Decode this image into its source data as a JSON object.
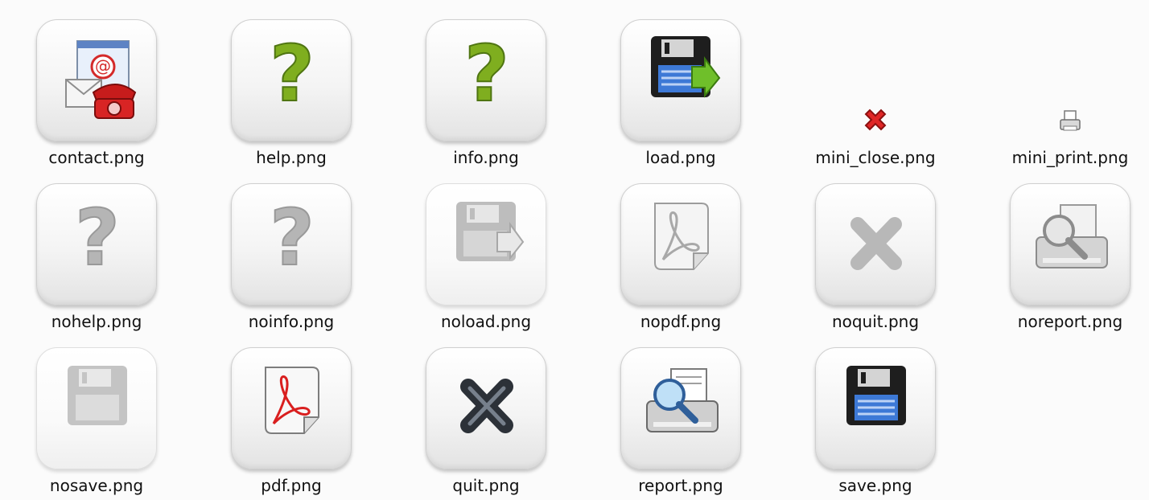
{
  "files": [
    {
      "name": "contact.png",
      "icon": "contact-icon"
    },
    {
      "name": "help.png",
      "icon": "help-icon"
    },
    {
      "name": "info.png",
      "icon": "info-icon"
    },
    {
      "name": "load.png",
      "icon": "load-icon"
    },
    {
      "name": "mini_close.png",
      "icon": "mini-close-icon"
    },
    {
      "name": "mini_print.png",
      "icon": "mini-print-icon"
    },
    {
      "name": "nohelp.png",
      "icon": "nohelp-icon"
    },
    {
      "name": "noinfo.png",
      "icon": "noinfo-icon"
    },
    {
      "name": "noload.png",
      "icon": "noload-icon"
    },
    {
      "name": "nopdf.png",
      "icon": "nopdf-icon"
    },
    {
      "name": "noquit.png",
      "icon": "noquit-icon"
    },
    {
      "name": "noreport.png",
      "icon": "noreport-icon"
    },
    {
      "name": "nosave.png",
      "icon": "nosave-icon"
    },
    {
      "name": "pdf.png",
      "icon": "pdf-icon"
    },
    {
      "name": "quit.png",
      "icon": "quit-icon"
    },
    {
      "name": "report.png",
      "icon": "report-icon"
    },
    {
      "name": "save.png",
      "icon": "save-icon"
    }
  ],
  "colors": {
    "help_green": "#7fae1f",
    "disk_blue": "#3d79d6",
    "pdf_red": "#d91f1f",
    "close_red": "#d42020",
    "disabled_gray": "#b5b5b5"
  }
}
